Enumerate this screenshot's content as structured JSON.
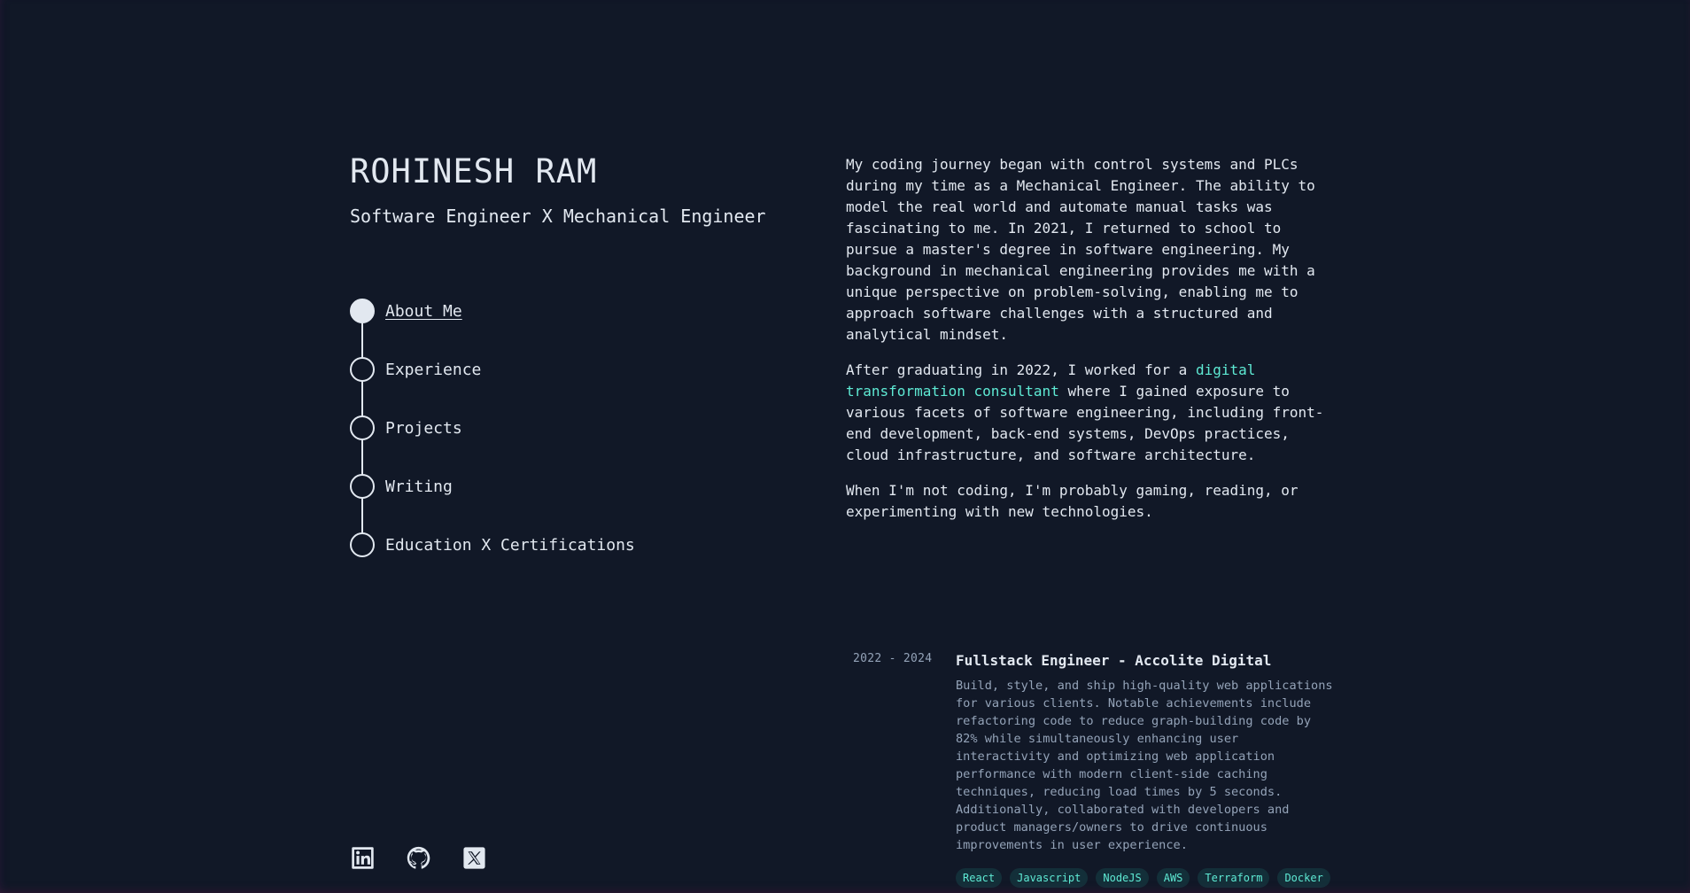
{
  "header": {
    "name": "ROHINESH RAM",
    "tagline": "Software Engineer X Mechanical Engineer"
  },
  "nav": {
    "items": [
      {
        "label": "About Me",
        "active": true
      },
      {
        "label": "Experience",
        "active": false
      },
      {
        "label": "Projects",
        "active": false
      },
      {
        "label": "Writing",
        "active": false
      },
      {
        "label": "Education X Certifications",
        "active": false
      }
    ]
  },
  "socials": [
    {
      "icon": "linkedin-icon"
    },
    {
      "icon": "github-icon"
    },
    {
      "icon": "x-twitter-icon"
    }
  ],
  "about": {
    "p1": "My coding journey began with control systems and PLCs during my time as a Mechanical Engineer. The ability to model the real world and automate manual tasks was fascinating to me. In 2021, I returned to school to pursue a master's degree in software engineering. My background in mechanical engineering provides me with a unique perspective on problem-solving, enabling me to approach software challenges with a structured and analytical mindset.",
    "p2_before": "After graduating in 2022, I worked for a ",
    "p2_link": "digital transformation consultant",
    "p2_after": " where I gained exposure to various facets of software engineering, including front-end development, back-end systems, DevOps practices, cloud infrastructure, and software architecture.",
    "p3": "When I'm not coding, I'm probably gaming, reading, or experimenting with new technologies."
  },
  "experience": {
    "date": "2022 - 2024",
    "title": "Fullstack Engineer - Accolite Digital",
    "description": "Build, style, and ship high-quality web applications for various clients. Notable achievements include refactoring code to reduce graph-building code by 82% while simultaneously enhancing user interactivity and optimizing web application performance with modern client-side caching techniques, reducing load times by 5 seconds. Additionally, collaborated with developers and product managers/owners to drive continuous improvements in user experience.",
    "tags": [
      "React",
      "Javascript",
      "NodeJS",
      "AWS",
      "Terraform",
      "Docker"
    ]
  },
  "colors": {
    "background": "#111827",
    "text": "#e2e8f0",
    "muted": "#94a3b8",
    "accent": "#5eead4"
  }
}
